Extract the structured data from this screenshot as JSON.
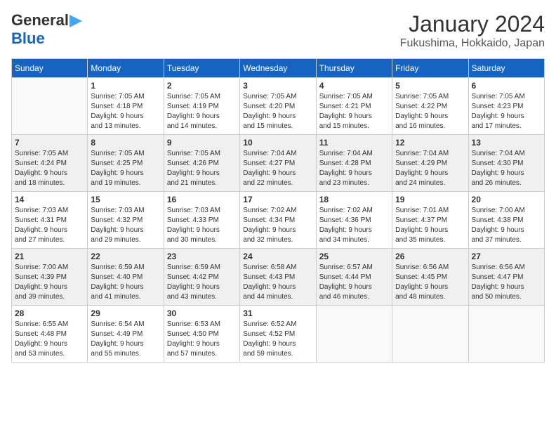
{
  "header": {
    "logo_general": "General",
    "logo_blue": "Blue",
    "title": "January 2024",
    "subtitle": "Fukushima, Hokkaido, Japan"
  },
  "weekdays": [
    "Sunday",
    "Monday",
    "Tuesday",
    "Wednesday",
    "Thursday",
    "Friday",
    "Saturday"
  ],
  "weeks": [
    [
      {
        "num": "",
        "info": ""
      },
      {
        "num": "1",
        "info": "Sunrise: 7:05 AM\nSunset: 4:18 PM\nDaylight: 9 hours\nand 13 minutes."
      },
      {
        "num": "2",
        "info": "Sunrise: 7:05 AM\nSunset: 4:19 PM\nDaylight: 9 hours\nand 14 minutes."
      },
      {
        "num": "3",
        "info": "Sunrise: 7:05 AM\nSunset: 4:20 PM\nDaylight: 9 hours\nand 15 minutes."
      },
      {
        "num": "4",
        "info": "Sunrise: 7:05 AM\nSunset: 4:21 PM\nDaylight: 9 hours\nand 15 minutes."
      },
      {
        "num": "5",
        "info": "Sunrise: 7:05 AM\nSunset: 4:22 PM\nDaylight: 9 hours\nand 16 minutes."
      },
      {
        "num": "6",
        "info": "Sunrise: 7:05 AM\nSunset: 4:23 PM\nDaylight: 9 hours\nand 17 minutes."
      }
    ],
    [
      {
        "num": "7",
        "info": ""
      },
      {
        "num": "8",
        "info": "Sunrise: 7:05 AM\nSunset: 4:25 PM\nDaylight: 9 hours\nand 19 minutes."
      },
      {
        "num": "9",
        "info": "Sunrise: 7:05 AM\nSunset: 4:26 PM\nDaylight: 9 hours\nand 21 minutes."
      },
      {
        "num": "10",
        "info": "Sunrise: 7:04 AM\nSunset: 4:27 PM\nDaylight: 9 hours\nand 22 minutes."
      },
      {
        "num": "11",
        "info": "Sunrise: 7:04 AM\nSunset: 4:28 PM\nDaylight: 9 hours\nand 23 minutes."
      },
      {
        "num": "12",
        "info": "Sunrise: 7:04 AM\nSunset: 4:29 PM\nDaylight: 9 hours\nand 24 minutes."
      },
      {
        "num": "13",
        "info": "Sunrise: 7:04 AM\nSunset: 4:30 PM\nDaylight: 9 hours\nand 26 minutes."
      }
    ],
    [
      {
        "num": "14",
        "info": ""
      },
      {
        "num": "15",
        "info": "Sunrise: 7:03 AM\nSunset: 4:32 PM\nDaylight: 9 hours\nand 29 minutes."
      },
      {
        "num": "16",
        "info": "Sunrise: 7:03 AM\nSunset: 4:33 PM\nDaylight: 9 hours\nand 30 minutes."
      },
      {
        "num": "17",
        "info": "Sunrise: 7:02 AM\nSunset: 4:34 PM\nDaylight: 9 hours\nand 32 minutes."
      },
      {
        "num": "18",
        "info": "Sunrise: 7:02 AM\nSunset: 4:36 PM\nDaylight: 9 hours\nand 34 minutes."
      },
      {
        "num": "19",
        "info": "Sunrise: 7:01 AM\nSunset: 4:37 PM\nDaylight: 9 hours\nand 35 minutes."
      },
      {
        "num": "20",
        "info": "Sunrise: 7:00 AM\nSunset: 4:38 PM\nDaylight: 9 hours\nand 37 minutes."
      }
    ],
    [
      {
        "num": "21",
        "info": ""
      },
      {
        "num": "22",
        "info": "Sunrise: 6:59 AM\nSunset: 4:40 PM\nDaylight: 9 hours\nand 41 minutes."
      },
      {
        "num": "23",
        "info": "Sunrise: 6:59 AM\nSunset: 4:42 PM\nDaylight: 9 hours\nand 43 minutes."
      },
      {
        "num": "24",
        "info": "Sunrise: 6:58 AM\nSunset: 4:43 PM\nDaylight: 9 hours\nand 44 minutes."
      },
      {
        "num": "25",
        "info": "Sunrise: 6:57 AM\nSunset: 4:44 PM\nDaylight: 9 hours\nand 46 minutes."
      },
      {
        "num": "26",
        "info": "Sunrise: 6:56 AM\nSunset: 4:45 PM\nDaylight: 9 hours\nand 48 minutes."
      },
      {
        "num": "27",
        "info": "Sunrise: 6:56 AM\nSunset: 4:47 PM\nDaylight: 9 hours\nand 50 minutes."
      }
    ],
    [
      {
        "num": "28",
        "info": ""
      },
      {
        "num": "29",
        "info": "Sunrise: 6:54 AM\nSunset: 4:49 PM\nDaylight: 9 hours\nand 55 minutes."
      },
      {
        "num": "30",
        "info": "Sunrise: 6:53 AM\nSunset: 4:50 PM\nDaylight: 9 hours\nand 57 minutes."
      },
      {
        "num": "31",
        "info": "Sunrise: 6:52 AM\nSunset: 4:52 PM\nDaylight: 9 hours\nand 59 minutes."
      },
      {
        "num": "",
        "info": ""
      },
      {
        "num": "",
        "info": ""
      },
      {
        "num": "",
        "info": ""
      }
    ]
  ],
  "week_day7_infos": [
    "Sunrise: 7:05 AM\nSunset: 4:24 PM\nDaylight: 9 hours\nand 18 minutes.",
    "Sunrise: 7:03 AM\nSunset: 4:31 PM\nDaylight: 9 hours\nand 27 minutes.",
    "Sunrise: 7:00 AM\nSunset: 4:39 PM\nDaylight: 9 hours\nand 39 minutes.",
    "Sunrise: 6:55 AM\nSunset: 4:48 PM\nDaylight: 9 hours\nand 53 minutes."
  ]
}
